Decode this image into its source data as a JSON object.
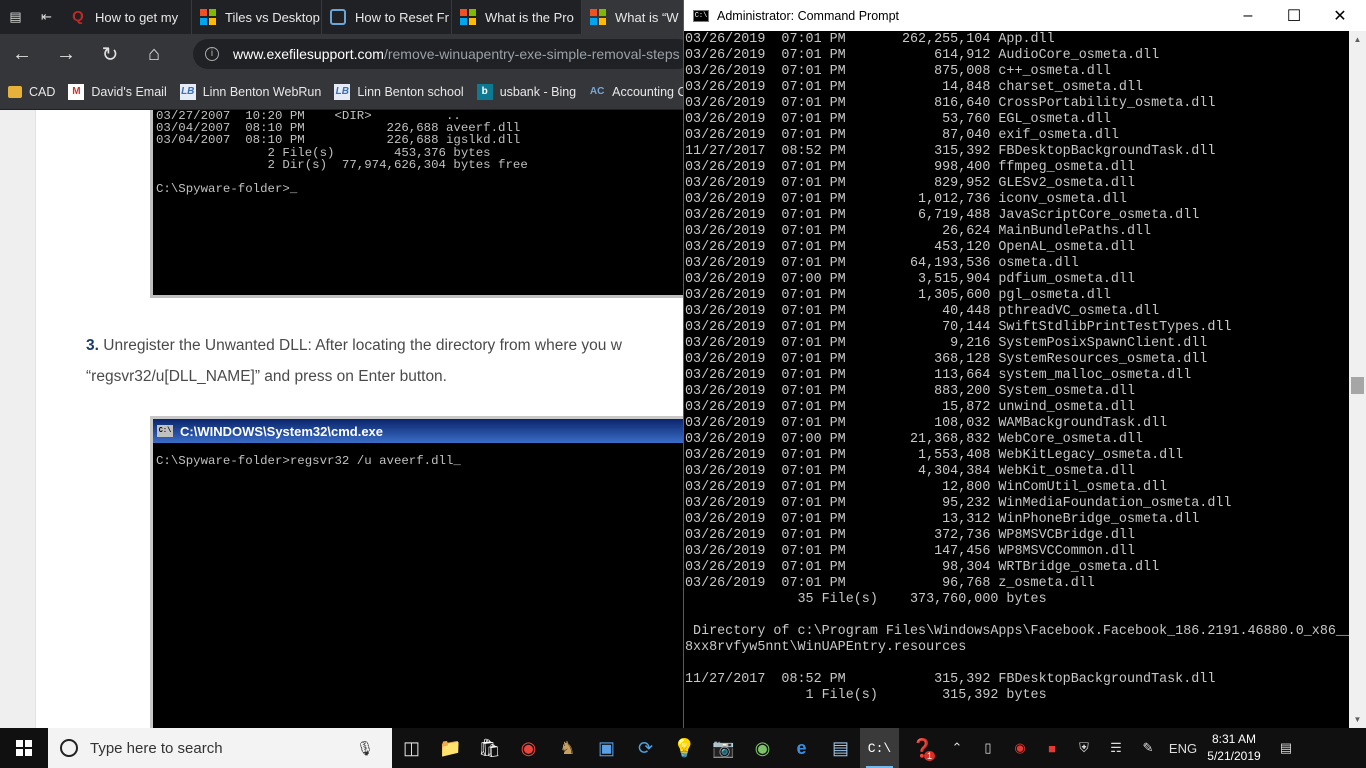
{
  "browser": {
    "tabs": [
      {
        "label": "How to get my",
        "icon": "quora-icon"
      },
      {
        "label": "Tiles vs Desktop",
        "icon": "microsoft-icon"
      },
      {
        "label": "How to Reset Fr",
        "icon": "reset-icon"
      },
      {
        "label": "What is the Pro",
        "icon": "microsoft-icon"
      },
      {
        "label": "What is “W",
        "icon": "microsoft-icon"
      }
    ],
    "url_host": "www.exefilesupport.com",
    "url_path": "/remove-winuapentry-exe-simple-removal-steps",
    "bookmarks": [
      {
        "label": "CAD",
        "icon": "folder-icon"
      },
      {
        "label": "David's Email",
        "icon": "gmail-icon"
      },
      {
        "label": "Linn Benton WebRun",
        "icon": "lb-icon"
      },
      {
        "label": "Linn Benton school",
        "icon": "lb-icon"
      },
      {
        "label": "usbank - Bing",
        "icon": "bing-icon"
      },
      {
        "label": "Accounting Coac",
        "icon": "ac-icon"
      }
    ]
  },
  "article": {
    "console1_lines": [
      "03/27/2007  10:20 PM    <DIR>          ..",
      "03/04/2007  08:10 PM           226,688 aveerf.dll",
      "03/04/2007  08:10 PM           226,688 igslkd.dll",
      "               2 File(s)        453,376 bytes",
      "               2 Dir(s)  77,974,626,304 bytes free",
      "",
      "C:\\Spyware-folder>_"
    ],
    "step_number": "3.",
    "step_title": "Unregister the Unwanted DLL:",
    "step_line1": " After locating the directory from where you w",
    "step_line2": "“regsvr32/u[DLL_NAME]” and press on Enter button.",
    "console2_title": "C:\\WINDOWS\\System32\\cmd.exe",
    "console2_line": "C:\\Spyware-folder>regsvr32 /u aveerf.dll_"
  },
  "cmd": {
    "title": "Administrator: Command Prompt",
    "lines": [
      "03/26/2019  07:01 PM       262,255,104 App.dll",
      "03/26/2019  07:01 PM           614,912 AudioCore_osmeta.dll",
      "03/26/2019  07:01 PM           875,008 c++_osmeta.dll",
      "03/26/2019  07:01 PM            14,848 charset_osmeta.dll",
      "03/26/2019  07:01 PM           816,640 CrossPortability_osmeta.dll",
      "03/26/2019  07:01 PM            53,760 EGL_osmeta.dll",
      "03/26/2019  07:01 PM            87,040 exif_osmeta.dll",
      "11/27/2017  08:52 PM           315,392 FBDesktopBackgroundTask.dll",
      "03/26/2019  07:01 PM           998,400 ffmpeg_osmeta.dll",
      "03/26/2019  07:01 PM           829,952 GLESv2_osmeta.dll",
      "03/26/2019  07:01 PM         1,012,736 iconv_osmeta.dll",
      "03/26/2019  07:01 PM         6,719,488 JavaScriptCore_osmeta.dll",
      "03/26/2019  07:01 PM            26,624 MainBundlePaths.dll",
      "03/26/2019  07:01 PM           453,120 OpenAL_osmeta.dll",
      "03/26/2019  07:01 PM        64,193,536 osmeta.dll",
      "03/26/2019  07:00 PM         3,515,904 pdfium_osmeta.dll",
      "03/26/2019  07:01 PM         1,305,600 pgl_osmeta.dll",
      "03/26/2019  07:01 PM            40,448 pthreadVC_osmeta.dll",
      "03/26/2019  07:01 PM            70,144 SwiftStdlibPrintTestTypes.dll",
      "03/26/2019  07:01 PM             9,216 SystemPosixSpawnClient.dll",
      "03/26/2019  07:01 PM           368,128 SystemResources_osmeta.dll",
      "03/26/2019  07:01 PM           113,664 system_malloc_osmeta.dll",
      "03/26/2019  07:01 PM           883,200 System_osmeta.dll",
      "03/26/2019  07:01 PM            15,872 unwind_osmeta.dll",
      "03/26/2019  07:01 PM           108,032 WAMBackgroundTask.dll",
      "03/26/2019  07:00 PM        21,368,832 WebCore_osmeta.dll",
      "03/26/2019  07:01 PM         1,553,408 WebKitLegacy_osmeta.dll",
      "03/26/2019  07:01 PM         4,304,384 WebKit_osmeta.dll",
      "03/26/2019  07:01 PM            12,800 WinComUtil_osmeta.dll",
      "03/26/2019  07:01 PM            95,232 WinMediaFoundation_osmeta.dll",
      "03/26/2019  07:01 PM            13,312 WinPhoneBridge_osmeta.dll",
      "03/26/2019  07:01 PM           372,736 WP8MSVCBridge.dll",
      "03/26/2019  07:01 PM           147,456 WP8MSVCCommon.dll",
      "03/26/2019  07:01 PM            98,304 WRTBridge_osmeta.dll",
      "03/26/2019  07:01 PM            96,768 z_osmeta.dll",
      "              35 File(s)    373,760,000 bytes",
      "",
      " Directory of c:\\Program Files\\WindowsApps\\Facebook.Facebook_186.2191.46880.0_x86__",
      "8xx8rvfyw5nnt\\WinUAPEntry.resources",
      "",
      "11/27/2017  08:52 PM           315,392 FBDesktopBackgroundTask.dll",
      "               1 File(s)        315,392 bytes"
    ]
  },
  "taskbar": {
    "search_placeholder": "Type here to search",
    "language": "ENG",
    "time": "8:31 AM",
    "date": "5/21/2019",
    "help_badge": "1"
  }
}
